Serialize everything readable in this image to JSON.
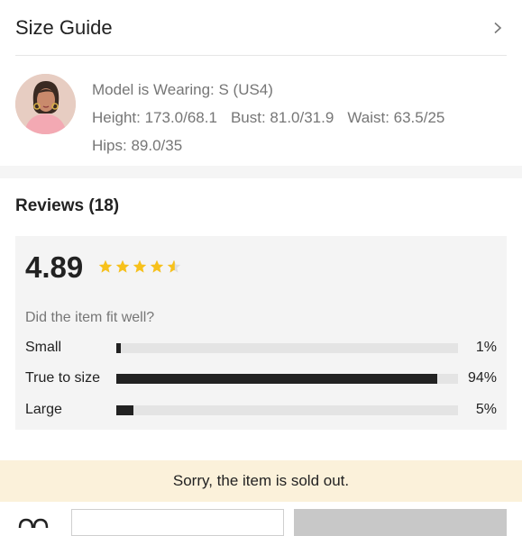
{
  "size_guide": {
    "title": "Size Guide"
  },
  "model": {
    "wearing": "Model is Wearing: S (US4)",
    "height": "Height: 173.0/68.1",
    "bust": "Bust: 81.0/31.9",
    "waist": "Waist: 63.5/25",
    "hips": "Hips: 89.0/35"
  },
  "reviews": {
    "title": "Reviews (18)",
    "score": "4.89",
    "stars": 4.89,
    "fit_question": "Did the item fit well?",
    "fit": [
      {
        "label": "Small",
        "percent_text": "1%",
        "value": 1
      },
      {
        "label": "True to size",
        "percent_text": "94%",
        "value": 94
      },
      {
        "label": "Large",
        "percent_text": "5%",
        "value": 5
      }
    ]
  },
  "soldout": {
    "message": "Sorry, the item is sold out."
  },
  "colors": {
    "star": "#f7c11b",
    "banner": "#fbf1da",
    "bar_fill": "#222222",
    "bar_track": "#e4e4e4"
  }
}
